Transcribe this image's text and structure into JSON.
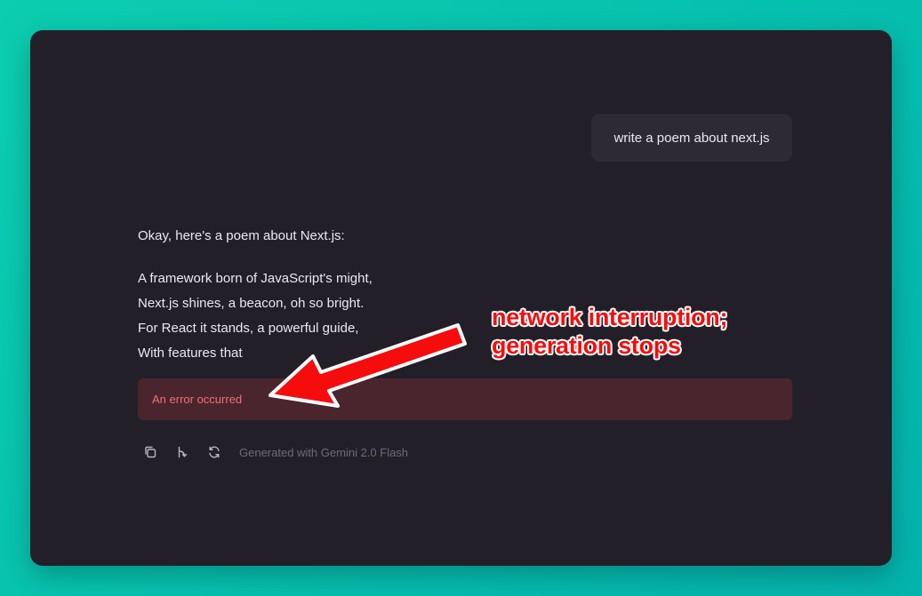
{
  "chat": {
    "user_message": "write a poem about next.js",
    "assistant_intro": "Okay, here's a poem about Next.js:",
    "poem_lines": [
      "A framework born of JavaScript's might,",
      "Next.js shines, a beacon, oh so bright.",
      "For React it stands, a powerful guide,",
      "With features that"
    ],
    "error_text": "An error occurred",
    "model_label": "Generated with Gemini 2.0 Flash"
  },
  "actions": [
    {
      "icon": "copy-icon"
    },
    {
      "icon": "branch-icon"
    },
    {
      "icon": "refresh-icon"
    }
  ],
  "annotation": {
    "line1": "network interruption;",
    "line2": "generation stops",
    "color": "#f50d0d"
  },
  "colors": {
    "background": "#0ccdb0",
    "panel": "#231f29",
    "bubble": "#2e2a34",
    "error_bg": "#4a252d",
    "error_text": "#ef6f72"
  }
}
